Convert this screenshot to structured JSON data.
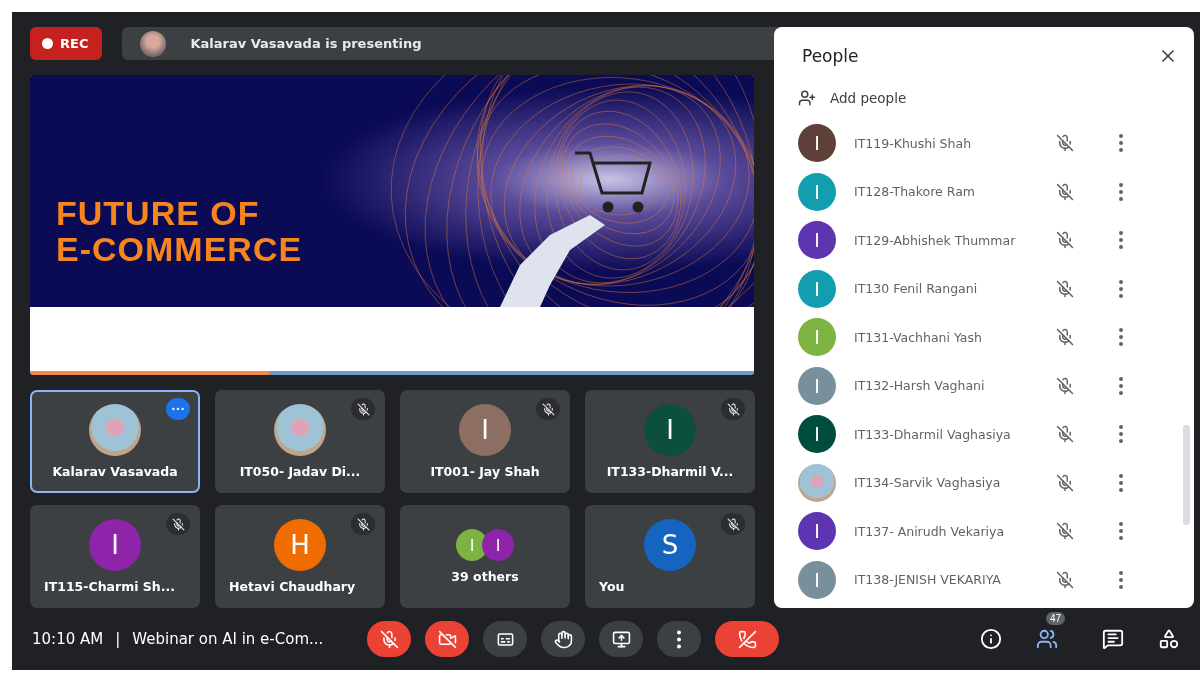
{
  "recording": {
    "label": "REC"
  },
  "presenter_bar": {
    "text": "Kalarav Vasavada is presenting"
  },
  "slide": {
    "title_lines": [
      "FUTURE OF",
      "E-COMMERCE"
    ]
  },
  "tiles": [
    {
      "name": "Kalarav Vasavada",
      "kind": "photo",
      "speaking": true,
      "muted": false
    },
    {
      "name": "IT050- Jadav Di...",
      "kind": "photo",
      "speaking": false,
      "muted": true
    },
    {
      "name": "IT001- Jay Shah",
      "kind": "initial",
      "initial": "I",
      "color": "#8d6e63",
      "speaking": false,
      "muted": true
    },
    {
      "name": "IT133-Dharmil V...",
      "kind": "initial",
      "initial": "I",
      "color": "#0b4f3c",
      "speaking": false,
      "muted": true
    },
    {
      "name": "IT115-Charmi Sh...",
      "kind": "initial",
      "initial": "I",
      "color": "#8e24aa",
      "speaking": false,
      "muted": true
    },
    {
      "name": "Hetavi Chaudhary",
      "kind": "initial",
      "initial": "H",
      "color": "#ef6c00",
      "speaking": false,
      "muted": true
    },
    {
      "name": "39 others",
      "kind": "others",
      "avatars": [
        {
          "initial": "I",
          "color": "#7cb342"
        },
        {
          "initial": "I",
          "color": "#8e24aa"
        }
      ],
      "speaking": false,
      "muted": false
    },
    {
      "name": "You",
      "kind": "initial",
      "initial": "S",
      "color": "#1565c0",
      "speaking": false,
      "muted": true
    }
  ],
  "bottom_bar": {
    "time": "10:10 AM",
    "separator": "|",
    "meeting_title": "Webinar on AI in e-Com...",
    "controls": [
      {
        "kind": "mic",
        "off": true
      },
      {
        "kind": "camera",
        "off": true
      },
      {
        "kind": "captions",
        "off": false
      },
      {
        "kind": "hand",
        "off": false
      },
      {
        "kind": "present",
        "off": false
      },
      {
        "kind": "more",
        "off": false
      },
      {
        "kind": "hangup"
      }
    ],
    "side_buttons": [
      {
        "kind": "info",
        "selected": false
      },
      {
        "kind": "people",
        "selected": true,
        "badge": "47"
      },
      {
        "kind": "chat",
        "selected": false
      },
      {
        "kind": "activities",
        "selected": false
      }
    ]
  },
  "people_panel": {
    "title": "People",
    "add_label": "Add people",
    "people": [
      {
        "name": "IT119-Khushi Shah",
        "kind": "initial",
        "initial": "I",
        "color": "#5d4037"
      },
      {
        "name": "IT128-Thakore Ram",
        "kind": "initial",
        "initial": "I",
        "color": "#129eaf"
      },
      {
        "name": "IT129-Abhishek Thummar",
        "kind": "initial",
        "initial": "I",
        "color": "#5e35b1"
      },
      {
        "name": "IT130 Fenil Rangani",
        "kind": "initial",
        "initial": "I",
        "color": "#129eaf"
      },
      {
        "name": "IT131-Vachhani Yash",
        "kind": "initial",
        "initial": "I",
        "color": "#7cb342"
      },
      {
        "name": "IT132-Harsh Vaghani",
        "kind": "initial",
        "initial": "I",
        "color": "#78909c"
      },
      {
        "name": "IT133-Dharmil Vaghasiya",
        "kind": "initial",
        "initial": "I",
        "color": "#004d40"
      },
      {
        "name": "IT134-Sarvik Vaghasiya",
        "kind": "photo"
      },
      {
        "name": "IT137- Anirudh Vekariya",
        "kind": "initial",
        "initial": "I",
        "color": "#5e35b1"
      },
      {
        "name": "IT138-JENISH VEKARIYA",
        "kind": "initial",
        "initial": "I",
        "color": "#78909c"
      }
    ]
  }
}
